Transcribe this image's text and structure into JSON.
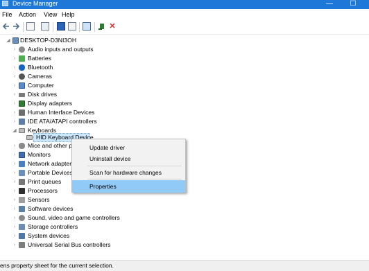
{
  "window": {
    "title": "Device Manager",
    "minimize": "—",
    "maximize": "☐"
  },
  "menu": [
    "File",
    "Action",
    "View",
    "Help"
  ],
  "tree": {
    "root": "DESKTOP-D3NI3OH",
    "items": [
      "Audio inputs and outputs",
      "Batteries",
      "Bluetooth",
      "Cameras",
      "Computer",
      "Disk drives",
      "Display adapters",
      "Human Interface Devices",
      "IDE ATA/ATAPI controllers",
      "Keyboards",
      "HID Keyboard Device",
      "Mice and other po",
      "Monitors",
      "Network adapters",
      "Portable Devices",
      "Print queues",
      "Processors",
      "Sensors",
      "Software devices",
      "Sound, video and game controllers",
      "Storage controllers",
      "System devices",
      "Universal Serial Bus controllers"
    ]
  },
  "context_menu": {
    "items": [
      "Update driver",
      "Uninstall device",
      "Scan for hardware changes",
      "Properties"
    ],
    "highlighted": "Properties"
  },
  "status": {
    "text": "ens property sheet for the current selection."
  },
  "colors": {
    "titlebar": "#1e78d7",
    "highlight": "#91c9f7",
    "selection": "#cce8ff"
  }
}
